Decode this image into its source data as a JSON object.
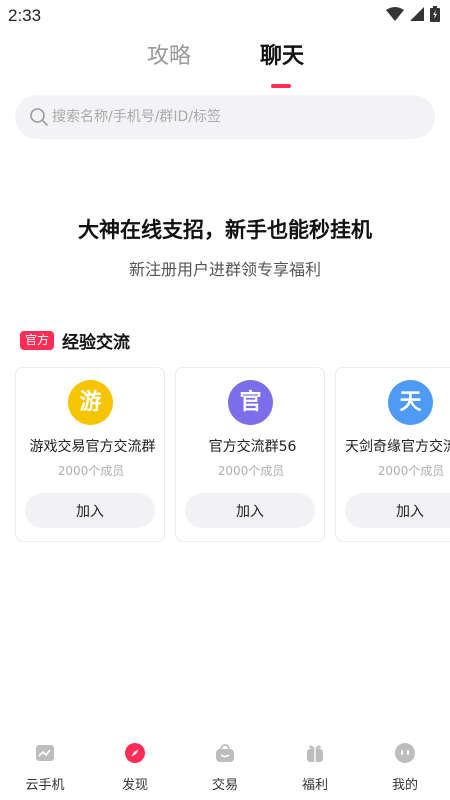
{
  "status_bar": {
    "time": "2:33"
  },
  "tabs": [
    {
      "label": "攻略",
      "active": false
    },
    {
      "label": "聊天",
      "active": true
    }
  ],
  "search": {
    "placeholder": "搜索名称/手机号/群ID/标签",
    "value": ""
  },
  "hero": {
    "title": "大神在线支招，新手也能秒挂机",
    "subtitle": "新注册用户进群领专享福利"
  },
  "section": {
    "badge": "官方",
    "title": "经验交流"
  },
  "groups": [
    {
      "avatar": "游",
      "avatar_color": "#f7c500",
      "name": "游戏交易官方交流群",
      "members": "2000个成员",
      "join_label": "加入"
    },
    {
      "avatar": "官",
      "avatar_color": "#7b6ee8",
      "name": "官方交流群56",
      "members": "2000个成员",
      "join_label": "加入"
    },
    {
      "avatar": "天",
      "avatar_color": "#4d9bf5",
      "name": "天剑奇缘官方交流群",
      "members": "2000个成员",
      "join_label": "加入"
    }
  ],
  "bottom_nav": [
    {
      "label": "云手机",
      "icon": "cloud-phone-icon",
      "active": false
    },
    {
      "label": "发现",
      "icon": "discover-icon",
      "active": true
    },
    {
      "label": "交易",
      "icon": "trade-icon",
      "active": false
    },
    {
      "label": "福利",
      "icon": "gift-icon",
      "active": false
    },
    {
      "label": "我的",
      "icon": "profile-icon",
      "active": false
    }
  ],
  "colors": {
    "accent": "#ff2c55",
    "muted": "#999999",
    "search_bg": "#f3f3f6",
    "nav_icon": "#bdbdbd"
  }
}
